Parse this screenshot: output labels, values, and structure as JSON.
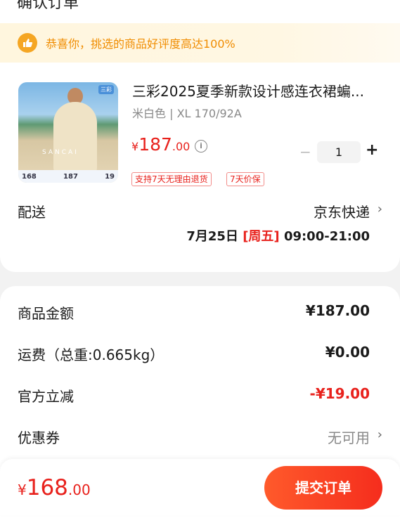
{
  "header": {
    "clipped_title": "确认订单"
  },
  "banner": {
    "text": "恭喜你，挑选的商品好评度高达100%",
    "icon": "thumbs-up-icon"
  },
  "product": {
    "title": "三彩2025夏季新款设计感连衣裙蝙...",
    "spec": "米白色 | XL 170/92A",
    "price_symbol": "¥",
    "price_int": "187",
    "price_dec": ".00",
    "quantity": "1",
    "minus_label": "−",
    "plus_label": "+",
    "tags": [
      "支持7天无理由退货",
      "7天价保"
    ],
    "thumb": {
      "badge": "三彩",
      "brand": "SANCAI",
      "left_num": "168",
      "mid_num": "187",
      "right_num": "19"
    }
  },
  "shipping": {
    "label": "配送",
    "method": "京东快递",
    "date": "7月25日",
    "weekday": "[周五]",
    "time": "09:00-21:00"
  },
  "fees": {
    "goods_label": "商品金额",
    "goods_value": "¥187.00",
    "freight_label": "运费（总重:0.665kg）",
    "freight_value": "¥0.00",
    "discount_label": "官方立减",
    "discount_value": "-¥19.00",
    "coupon_label": "优惠券",
    "coupon_value": "无可用"
  },
  "footer": {
    "total_symbol": "¥",
    "total_int": "168",
    "total_dec": ".00",
    "submit_label": "提交订单"
  },
  "colors": {
    "accent": "#e8211c",
    "banner_text": "#f08c00",
    "submit": "#f52d1d"
  }
}
